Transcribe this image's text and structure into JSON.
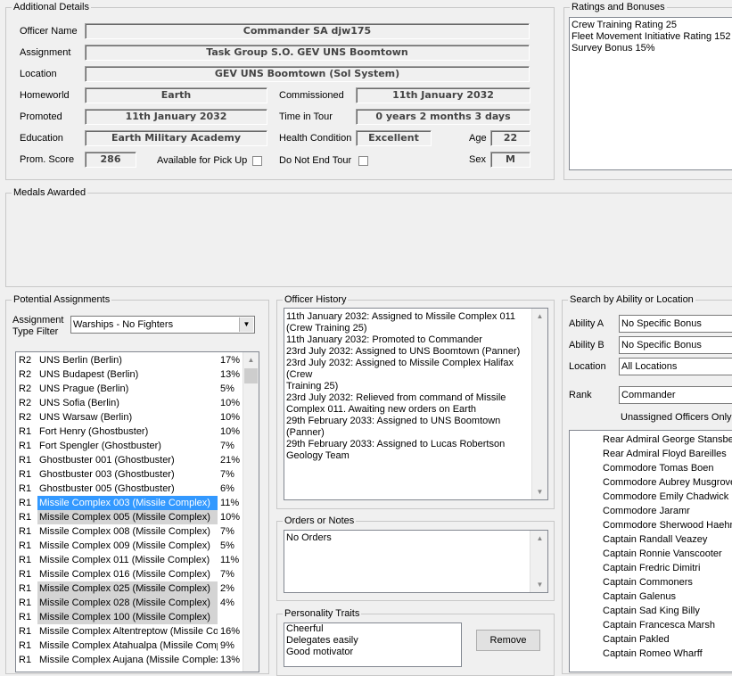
{
  "details": {
    "title": "Additional Details",
    "officer_name_label": "Officer Name",
    "officer_name": "Commander SA djw175",
    "assignment_label": "Assignment",
    "assignment": "Task Group S.O. GEV UNS Boomtown",
    "location_label": "Location",
    "location": "GEV UNS Boomtown (Sol System)",
    "homeworld_label": "Homeworld",
    "homeworld": "Earth",
    "commissioned_label": "Commissioned",
    "commissioned": "11th January 2032",
    "promoted_label": "Promoted",
    "promoted": "11th January 2032",
    "time_in_tour_label": "Time in Tour",
    "time_in_tour": "0 years 2 months 3 days",
    "education_label": "Education",
    "education": "Earth Military Academy",
    "health_label": "Health Condition",
    "health": "Excellent",
    "age_label": "Age",
    "age": "22",
    "prom_score_label": "Prom. Score",
    "prom_score": "286",
    "pickup_label": "Available for Pick Up",
    "not_end_tour_label": "Do Not End Tour",
    "sex_label": "Sex",
    "sex": "M"
  },
  "ratings": {
    "title": "Ratings and Bonuses",
    "lines": [
      "Crew Training Rating 25",
      "Fleet Movement Initiative Rating 152",
      "Survey Bonus 15%"
    ]
  },
  "medals": {
    "title": "Medals Awarded"
  },
  "potential": {
    "title": "Potential Assignments",
    "filter_label": "Assignment Type Filter",
    "filter_value": "Warships - No Fighters",
    "rows": [
      {
        "rank": "R2",
        "name": "UNS Berlin (Berlin)",
        "pct": "17%"
      },
      {
        "rank": "R2",
        "name": "UNS Budapest (Berlin)",
        "pct": "13%"
      },
      {
        "rank": "R2",
        "name": "UNS Prague (Berlin)",
        "pct": "5%"
      },
      {
        "rank": "R2",
        "name": "UNS Sofia (Berlin)",
        "pct": "10%"
      },
      {
        "rank": "R2",
        "name": "UNS Warsaw (Berlin)",
        "pct": "10%"
      },
      {
        "rank": "R1",
        "name": "Fort Henry (Ghostbuster)",
        "pct": "10%"
      },
      {
        "rank": "R1",
        "name": "Fort Spengler (Ghostbuster)",
        "pct": "7%"
      },
      {
        "rank": "R1",
        "name": "Ghostbuster 001 (Ghostbuster)",
        "pct": "21%"
      },
      {
        "rank": "R1",
        "name": "Ghostbuster 003 (Ghostbuster)",
        "pct": "7%"
      },
      {
        "rank": "R1",
        "name": "Ghostbuster 005 (Ghostbuster)",
        "pct": "6%"
      },
      {
        "rank": "R1",
        "name": "Missile Complex 003 (Missile Complex)",
        "pct": "11%"
      },
      {
        "rank": "R1",
        "name": "Missile Complex 005 (Missile Complex)",
        "pct": "10%"
      },
      {
        "rank": "R1",
        "name": "Missile Complex 008 (Missile Complex)",
        "pct": "7%"
      },
      {
        "rank": "R1",
        "name": "Missile Complex 009 (Missile Complex)",
        "pct": "5%"
      },
      {
        "rank": "R1",
        "name": "Missile Complex 011 (Missile Complex)",
        "pct": "11%"
      },
      {
        "rank": "R1",
        "name": "Missile Complex 016 (Missile Complex)",
        "pct": "7%"
      },
      {
        "rank": "R1",
        "name": "Missile Complex 025 (Missile Complex)",
        "pct": "2%"
      },
      {
        "rank": "R1",
        "name": "Missile Complex 028 (Missile Complex)",
        "pct": "4%"
      },
      {
        "rank": "R1",
        "name": "Missile Complex 100 (Missile Complex)",
        "pct": ""
      },
      {
        "rank": "R1",
        "name": "Missile Complex Altentreptow (Missile Com",
        "pct": "16%"
      },
      {
        "rank": "R1",
        "name": "Missile Complex Atahualpa (Missile Comple",
        "pct": "9%"
      },
      {
        "rank": "R1",
        "name": "Missile Complex Aujana (Missile Complex)",
        "pct": "13%"
      }
    ]
  },
  "history": {
    "title": "Officer History",
    "lines": [
      "11th January 2032: Assigned to Missile Complex 011",
      "(Crew Training 25)",
      "11th January 2032: Promoted to Commander",
      "23rd July 2032: Assigned to UNS Boomtown (Panner)",
      "23rd July 2032: Assigned to Missile Complex Halifax (Crew",
      "Training 25)",
      "23rd July 2032: Relieved from command of Missile",
      "Complex 011. Awaiting new orders on Earth",
      "29th February 2033: Assigned to UNS Boomtown",
      "(Panner)",
      "29th February 2033: Assigned to Lucas Robertson",
      "Geology Team"
    ]
  },
  "orders": {
    "title": "Orders or Notes",
    "text": "No Orders"
  },
  "traits": {
    "title": "Personality Traits",
    "items": [
      "Cheerful",
      "Delegates easily",
      "Good motivator"
    ],
    "remove_label": "Remove"
  },
  "search": {
    "title": "Search by Ability or Location",
    "ability_a_label": "Ability A",
    "ability_a": "No Specific Bonus",
    "ability_b_label": "Ability B",
    "ability_b": "No Specific Bonus",
    "location_label": "Location",
    "location": "All Locations",
    "rank_label": "Rank",
    "rank": "Commander",
    "unassigned_label": "Unassigned Officers Only",
    "officers": [
      "Rear Admiral George Stansber",
      "Rear Admiral Floyd Bareilles",
      "Commodore Tomas Boen",
      "Commodore Aubrey Musgrove",
      "Commodore Emily Chadwick",
      "Commodore Jaramr",
      "Commodore Sherwood Haehn",
      "Captain Randall Veazey",
      "Captain Ronnie Vanscooter",
      "Captain Fredric Dimitri",
      "Captain Commoners",
      "Captain Galenus",
      "Captain Sad King Billy",
      "Captain Francesca Marsh",
      "Captain Pakled",
      "Captain Romeo Wharff"
    ]
  }
}
